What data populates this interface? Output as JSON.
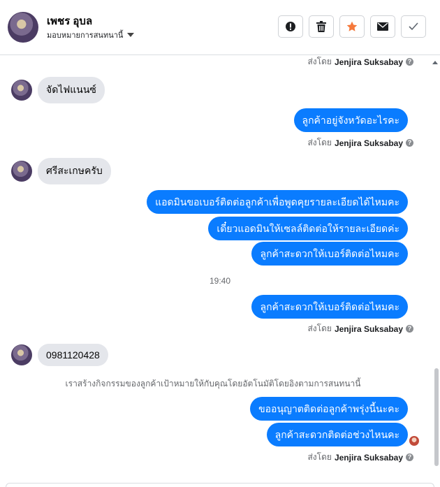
{
  "header": {
    "contact_name": "เพชร อุบล",
    "assign_label": "มอบหมายการสนทนานี้"
  },
  "toolbar": {
    "spam": "exclamation-icon",
    "delete": "trash-icon",
    "star": "star-icon",
    "mail": "envelope-icon",
    "done": "check-icon",
    "star_color": "#f5793b"
  },
  "sent_by": {
    "prefix": "ส่งโดย",
    "agent": "Jenjira Suksabay"
  },
  "messages": {
    "in_1": "จัดไฟแนนซ์",
    "out_1": "ลูกค้าอยู่จังหวัดอะไรคะ",
    "in_2": "ศรีสะเกษครับ",
    "out_2": "แอดมินขอเบอร์ติดต่อลูกค้าเพื่อพูดคุยรายละเอียดได้ไหมคะ",
    "out_3": "เดี๋ยวแอดมินให้เซลล์ติดต่อให้รายละเอียดค่ะ",
    "out_4": "ลูกค้าสะดวกให้เบอร์ติดต่อไหมคะ",
    "time_1": "19:40",
    "out_5": "ลูกค้าสะดวกให้เบอร์ติดต่อไหมคะ",
    "in_3": "0981120428",
    "system": "เราสร้างกิจกรรมของลูกค้าเป้าหมายให้กับคุณโดยอัตโนมัติโดยอิงตามการสนทนานี้",
    "out_6": "ขออนุญาตติดต่อลูกค้าพรุ่งนี้นะคะ",
    "out_7": "ลูกค้าสะดวกติดต่อช่วงไหนคะ"
  },
  "colors": {
    "outgoing_bubble": "#0a7cff",
    "incoming_bubble": "#e4e6eb"
  }
}
